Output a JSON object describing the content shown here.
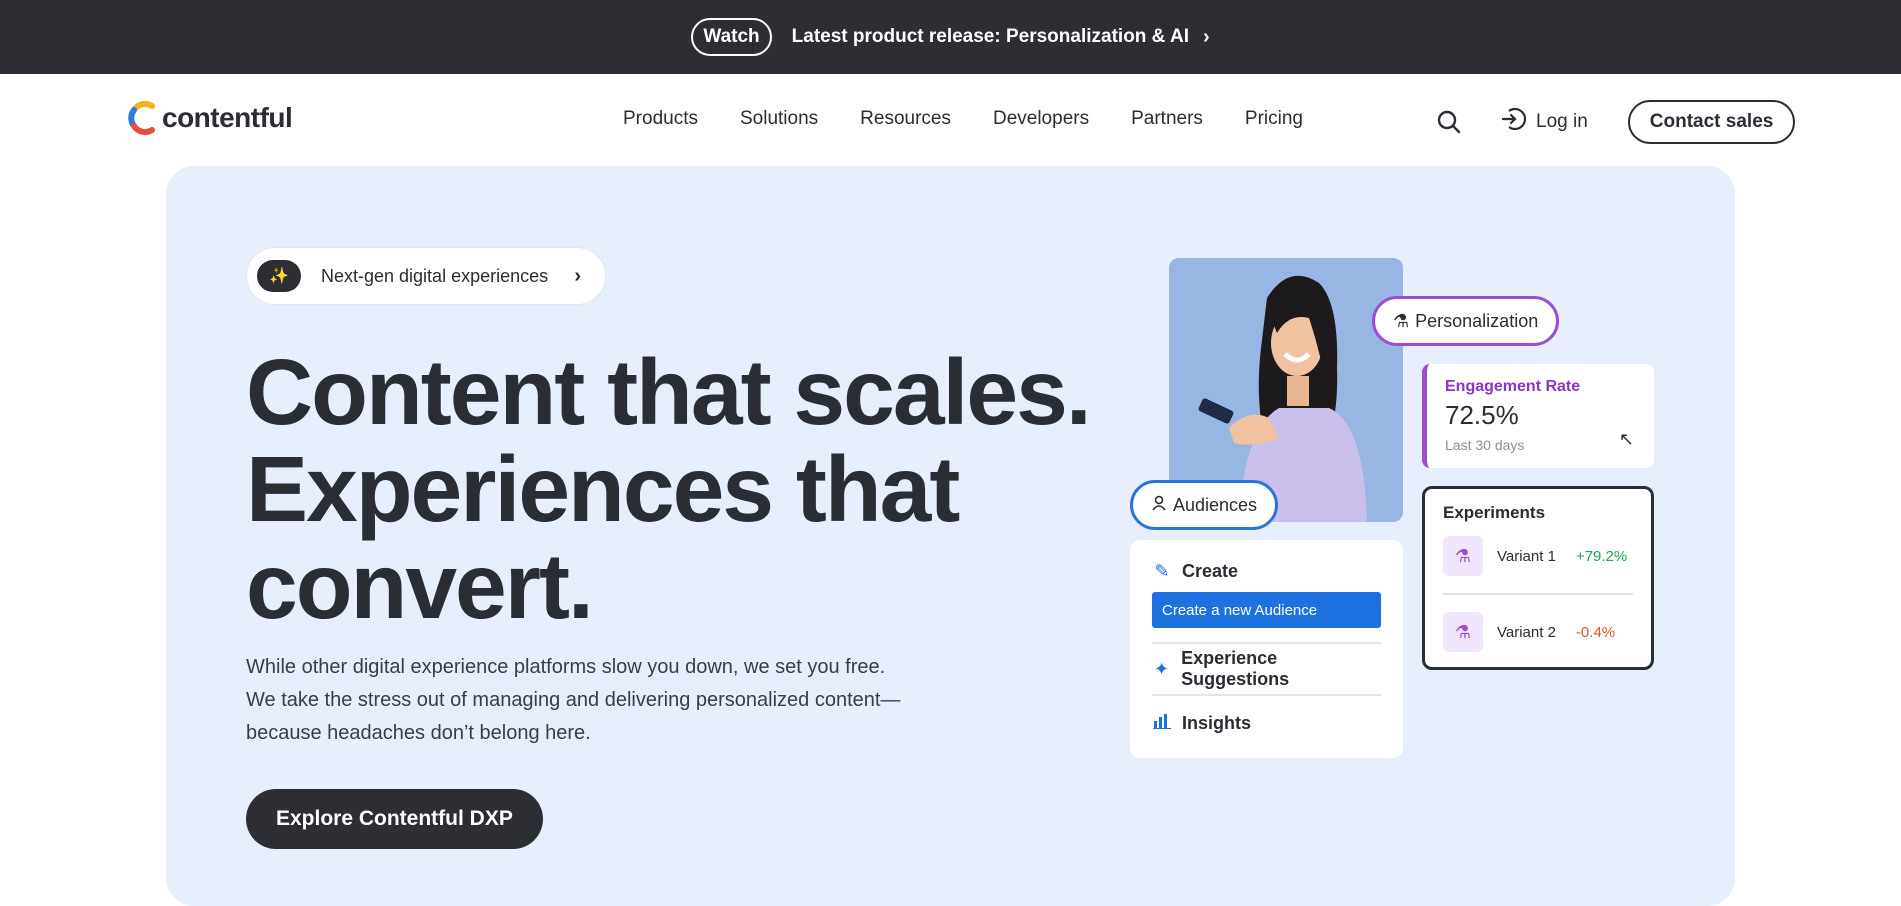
{
  "announcement": {
    "watch_label": "Watch",
    "text": "Latest product release: Personalization & AI",
    "chevron_icon": "chevron-right-icon"
  },
  "nav": {
    "logo_text": "contentful",
    "links": [
      "Products",
      "Solutions",
      "Resources",
      "Developers",
      "Partners",
      "Pricing"
    ],
    "login_label": "Log in",
    "contact_label": "Contact sales"
  },
  "hero": {
    "pill_label": "Next-gen digital experiences",
    "headline_lines": [
      "Content that scales.",
      "Experiences that",
      "convert."
    ],
    "subtext": "While other digital experience platforms slow you down, we set you free. We take the stress out of managing and delivering personalized content—because headaches don’t belong here.",
    "cta_label": "Explore Contentful DXP"
  },
  "illustration": {
    "personalization_tag": "Personalization",
    "engagement": {
      "title": "Engagement Rate",
      "value": "72.5%",
      "period": "Last 30 days"
    },
    "audiences_tag": "Audiences",
    "create_card": {
      "create_label": "Create",
      "new_audience_button": "Create a new Audience",
      "suggestions_label": "Experience Suggestions",
      "insights_label": "Insights"
    },
    "experiments": {
      "title": "Experiments",
      "variants": [
        {
          "name": "Variant 1",
          "delta": "+79.2%"
        },
        {
          "name": "Variant 2",
          "delta": "-0.4%"
        }
      ]
    }
  },
  "colors": {
    "announce_bg": "#2c2e33",
    "hero_bg": "#e7effc",
    "accent_purple": "#9b4ecf",
    "accent_blue": "#1e72e0",
    "positive": "#21a458",
    "negative": "#d4582b"
  }
}
